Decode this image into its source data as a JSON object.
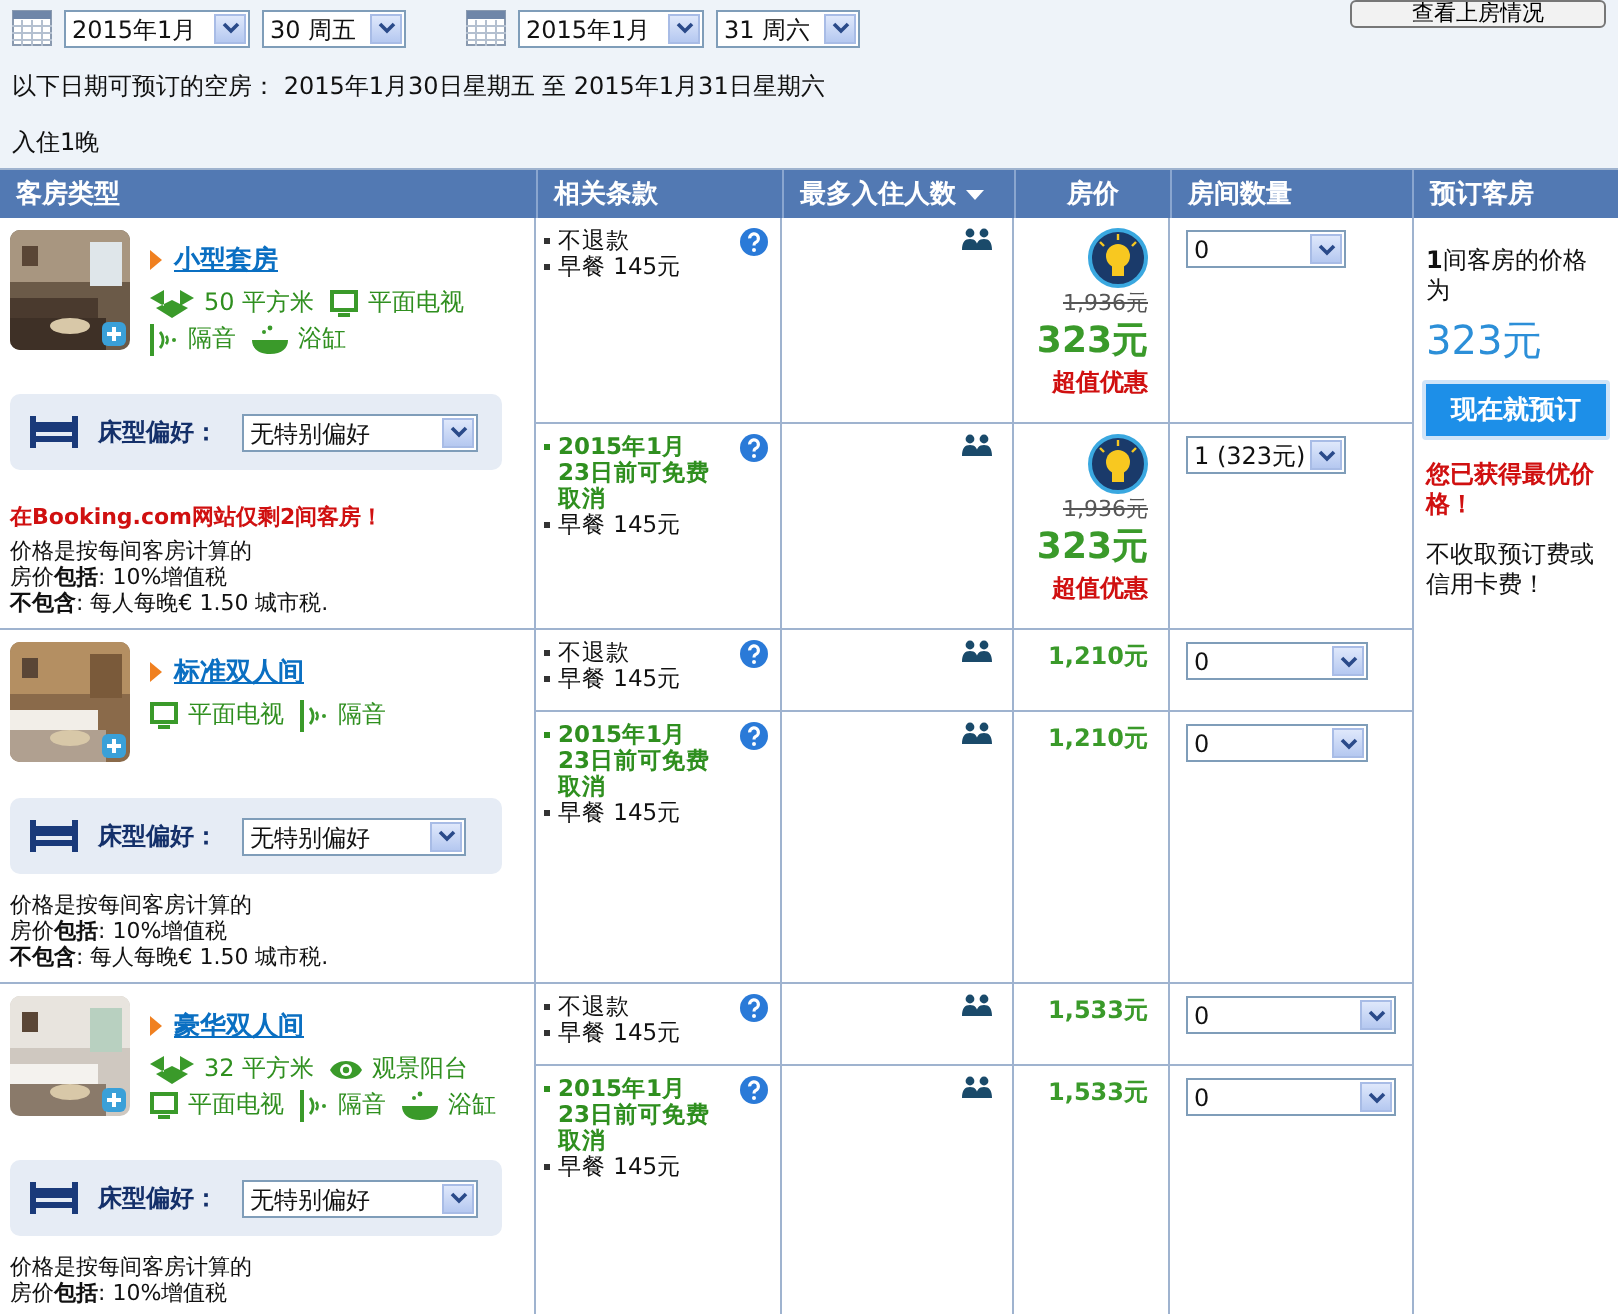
{
  "top_button": "查看上房情况",
  "date_pickers": [
    {
      "month": "2015年1月",
      "day": "30 周五"
    },
    {
      "month": "2015年1月",
      "day": "31 周六"
    }
  ],
  "availability": "以下日期可预订的空房：  2015年1月30日星期五 至 2015年1月31日星期六",
  "nights": "入住1晚",
  "columns": [
    {
      "label": "客房类型",
      "sorted": false
    },
    {
      "label": "相关条款",
      "sorted": false
    },
    {
      "label": "最多入住人数",
      "sorted": true
    },
    {
      "label": "房价",
      "sorted": false
    },
    {
      "label": "房间数量",
      "sorted": false
    },
    {
      "label": "预订客房",
      "sorted": false
    }
  ],
  "rooms": [
    {
      "name": "小型套房",
      "feature_rows": [
        [
          {
            "kind": "area",
            "label": "50 平方米"
          },
          {
            "kind": "tv",
            "label": "平面电视"
          }
        ],
        [
          {
            "kind": "soundproof",
            "label": "隔音"
          },
          {
            "kind": "bath",
            "label": "浴缸"
          }
        ]
      ],
      "bed_label": "床型偏好：",
      "bed_value": "无特别偏好",
      "alert": "在Booking.com网站仅剩2间客房！",
      "notes": [
        "价格是按每间客房计算的",
        "房价**包括**: 10%增值税",
        "**不包含**: 每人每晚€ 1.50 城市税."
      ],
      "offers": [
        {
          "terms": [
            {
              "kind": "plain",
              "text": "不退款"
            },
            {
              "kind": "plain",
              "text": "早餐 145元"
            }
          ],
          "deal": true,
          "old_price": "1,936元",
          "price": "323元",
          "deal_label": "超值优惠",
          "quantity": "0"
        },
        {
          "terms": [
            {
              "kind": "free_cancel",
              "text": "2015年1月23日前可免费取消"
            },
            {
              "kind": "plain",
              "text": "早餐 145元"
            }
          ],
          "deal": true,
          "old_price": "1,936元",
          "price": "323元",
          "deal_label": "超值优惠",
          "quantity": "1 (323元)"
        }
      ]
    },
    {
      "name": "标准双人间",
      "feature_rows": [
        [
          {
            "kind": "tv",
            "label": "平面电视"
          },
          {
            "kind": "soundproof",
            "label": "隔音"
          }
        ]
      ],
      "bed_label": "床型偏好：",
      "bed_value": "无特别偏好",
      "notes": [
        "价格是按每间客房计算的",
        "房价**包括**: 10%增值税",
        "**不包含**: 每人每晚€ 1.50 城市税."
      ],
      "offers": [
        {
          "terms": [
            {
              "kind": "plain",
              "text": "不退款"
            },
            {
              "kind": "plain",
              "text": "早餐 145元"
            }
          ],
          "deal": false,
          "price": "1,210元",
          "quantity": "0"
        },
        {
          "terms": [
            {
              "kind": "free_cancel",
              "text": "2015年1月23日前可免费取消"
            },
            {
              "kind": "plain",
              "text": "早餐 145元"
            }
          ],
          "deal": false,
          "price": "1,210元",
          "quantity": "0"
        }
      ]
    },
    {
      "name": "豪华双人间",
      "feature_rows": [
        [
          {
            "kind": "area",
            "label": "32 平方米"
          },
          {
            "kind": "view",
            "label": "观景阳台"
          }
        ],
        [
          {
            "kind": "tv",
            "label": "平面电视"
          },
          {
            "kind": "soundproof",
            "label": "隔音"
          },
          {
            "kind": "bath",
            "label": "浴缸"
          }
        ]
      ],
      "bed_label": "床型偏好：",
      "bed_value": "无特别偏好",
      "notes": [
        "价格是按每间客房计算的",
        "房价**包括**: 10%增值税"
      ],
      "offers": [
        {
          "terms": [
            {
              "kind": "plain",
              "text": "不退款"
            },
            {
              "kind": "plain",
              "text": "早餐 145元"
            }
          ],
          "deal": false,
          "price": "1,533元",
          "quantity": "0"
        },
        {
          "terms": [
            {
              "kind": "free_cancel",
              "text": "2015年1月23日前可免费取消"
            },
            {
              "kind": "plain",
              "text": "早餐 145元"
            }
          ],
          "deal": false,
          "price": "1,533元",
          "quantity": "0"
        }
      ]
    }
  ],
  "booking": {
    "summary": "**1**间客房的价格为",
    "total": "323元",
    "button": "现在就预订",
    "best_price": "您已获得最优价格！",
    "no_fee": "不收取预订费或信用卡费！"
  }
}
